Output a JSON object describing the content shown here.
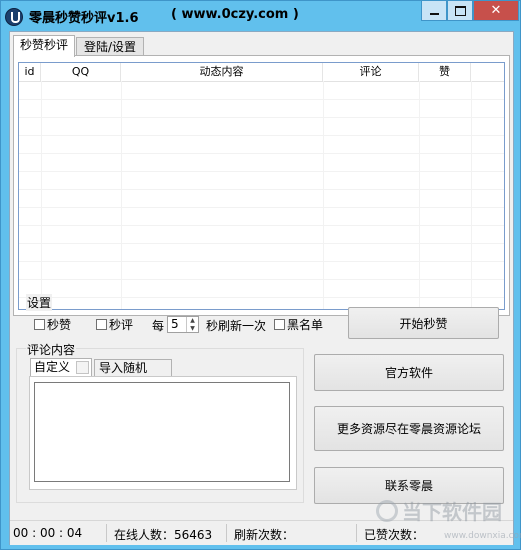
{
  "window": {
    "title": "零晨秒赞秒评v1.6",
    "url": "( www.0czy.com )",
    "minimize": "",
    "maximize": "",
    "close": "✕"
  },
  "tabs": [
    "秒赞秒评",
    "登陆/设置"
  ],
  "list": {
    "columns": [
      "id",
      "QQ",
      "动态内容",
      "评论",
      "赞"
    ]
  },
  "settings": {
    "group_label": "设置",
    "like_label": "秒赞",
    "comment_label": "秒评",
    "every_label": "每",
    "interval_value": "5",
    "refresh_label": "秒刷新一次",
    "blacklist_label": "黑名单",
    "start_button": "开始秒赞"
  },
  "comment": {
    "group_label": "评论内容",
    "tab_custom": "自定义",
    "tab_import": "导入随机"
  },
  "buttons": {
    "official": "官方软件",
    "forum": "更多资源尽在零晨资源论坛",
    "contact": "联系零晨"
  },
  "status": {
    "timer": "00 : 00 : 04",
    "online": "在线人数：56463",
    "refresh_count": "刷新次数：",
    "liked_count": "已赞次数："
  },
  "watermark": {
    "text": "当下软件园",
    "url": "www.downxia.com"
  }
}
